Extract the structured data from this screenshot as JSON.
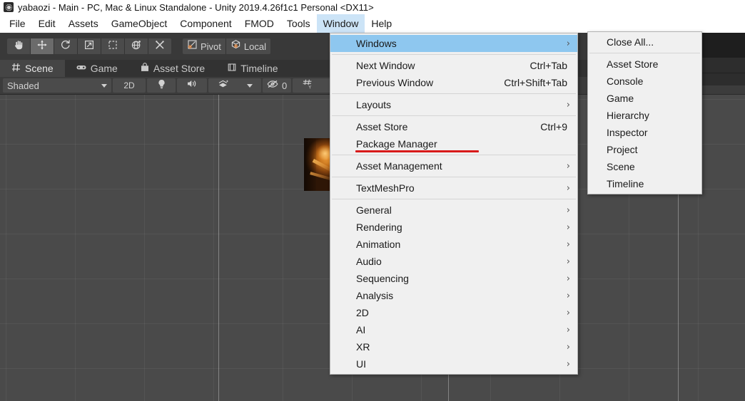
{
  "titlebar": {
    "icon": "unity-app-icon",
    "text": "yabaozi - Main - PC, Mac & Linux Standalone - Unity 2019.4.26f1c1 Personal <DX11>"
  },
  "menubar": {
    "items": [
      {
        "label": "File",
        "active": false
      },
      {
        "label": "Edit",
        "active": false
      },
      {
        "label": "Assets",
        "active": false
      },
      {
        "label": "GameObject",
        "active": false
      },
      {
        "label": "Component",
        "active": false
      },
      {
        "label": "FMOD",
        "active": false
      },
      {
        "label": "Tools",
        "active": false
      },
      {
        "label": "Window",
        "active": true
      },
      {
        "label": "Help",
        "active": false
      }
    ]
  },
  "toolbar": {
    "tools": [
      {
        "name": "hand-tool",
        "selected": false
      },
      {
        "name": "move-tool",
        "selected": true
      },
      {
        "name": "rotate-tool",
        "selected": false
      },
      {
        "name": "scale-tool",
        "selected": false
      },
      {
        "name": "rect-tool",
        "selected": false
      },
      {
        "name": "transform-tool",
        "selected": false
      },
      {
        "name": "custom-tool",
        "selected": false
      }
    ],
    "pivot_label": "Pivot",
    "handle_label": "Local"
  },
  "tabs": [
    {
      "label": "Scene",
      "icon": "scene-grid-icon",
      "active": true
    },
    {
      "label": "Game",
      "icon": "gamepad-icon",
      "active": false
    },
    {
      "label": "Asset Store",
      "icon": "store-bag-icon",
      "active": false
    },
    {
      "label": "Timeline",
      "icon": "timeline-icon",
      "active": false
    }
  ],
  "scenebar": {
    "draw_mode": "Shaded",
    "twod_label": "2D",
    "lighting_icon": "lightbulb-icon",
    "audio_icon": "speaker-icon",
    "fx_icon": "effects-icon",
    "visibility_icon": "hidden-eye-icon",
    "hidden_count": "0",
    "grid_icon": "grid-snap-icon"
  },
  "menu_window": {
    "title": "Window",
    "items": [
      {
        "label": "Windows",
        "accel": "",
        "arrow": true,
        "highlighted": true,
        "separator_after": true
      },
      {
        "label": "Next Window",
        "accel": "Ctrl+Tab",
        "arrow": false,
        "highlighted": false,
        "separator_after": false
      },
      {
        "label": "Previous Window",
        "accel": "Ctrl+Shift+Tab",
        "arrow": false,
        "highlighted": false,
        "separator_after": true
      },
      {
        "label": "Layouts",
        "accel": "",
        "arrow": true,
        "highlighted": false,
        "separator_after": true
      },
      {
        "label": "Asset Store",
        "accel": "Ctrl+9",
        "arrow": false,
        "highlighted": false,
        "separator_after": false
      },
      {
        "label": "Package Manager",
        "accel": "",
        "arrow": false,
        "highlighted": false,
        "separator_after": true,
        "underlined": true
      },
      {
        "label": "Asset Management",
        "accel": "",
        "arrow": true,
        "highlighted": false,
        "separator_after": true
      },
      {
        "label": "TextMeshPro",
        "accel": "",
        "arrow": true,
        "highlighted": false,
        "separator_after": true
      },
      {
        "label": "General",
        "accel": "",
        "arrow": true,
        "highlighted": false,
        "separator_after": false
      },
      {
        "label": "Rendering",
        "accel": "",
        "arrow": true,
        "highlighted": false,
        "separator_after": false
      },
      {
        "label": "Animation",
        "accel": "",
        "arrow": true,
        "highlighted": false,
        "separator_after": false
      },
      {
        "label": "Audio",
        "accel": "",
        "arrow": true,
        "highlighted": false,
        "separator_after": false
      },
      {
        "label": "Sequencing",
        "accel": "",
        "arrow": true,
        "highlighted": false,
        "separator_after": false
      },
      {
        "label": "Analysis",
        "accel": "",
        "arrow": true,
        "highlighted": false,
        "separator_after": false
      },
      {
        "label": "2D",
        "accel": "",
        "arrow": true,
        "highlighted": false,
        "separator_after": false
      },
      {
        "label": "AI",
        "accel": "",
        "arrow": true,
        "highlighted": false,
        "separator_after": false
      },
      {
        "label": "XR",
        "accel": "",
        "arrow": true,
        "highlighted": false,
        "separator_after": false
      },
      {
        "label": "UI",
        "accel": "",
        "arrow": true,
        "highlighted": false,
        "separator_after": false
      }
    ]
  },
  "menu_windows_submenu": {
    "items": [
      {
        "label": "Close All...",
        "separator_after": true
      },
      {
        "label": "Asset Store",
        "separator_after": false
      },
      {
        "label": "Console",
        "separator_after": false
      },
      {
        "label": "Game",
        "separator_after": false
      },
      {
        "label": "Hierarchy",
        "separator_after": false
      },
      {
        "label": "Inspector",
        "separator_after": false
      },
      {
        "label": "Project",
        "separator_after": false
      },
      {
        "label": "Scene",
        "separator_after": false
      },
      {
        "label": "Timeline",
        "separator_after": false
      }
    ]
  },
  "annotation": {
    "type": "red-underline",
    "target": "Package Manager",
    "color": "#d81a1a"
  },
  "colors": {
    "menu_background": "#f0f0f0",
    "menu_highlight": "#8ec7ef",
    "menubar_highlight": "#cce4f7",
    "editor_chrome": "#393939",
    "viewport": "#4a4a4a",
    "tab_active": "#454545",
    "annotation_red": "#d81a1a"
  }
}
